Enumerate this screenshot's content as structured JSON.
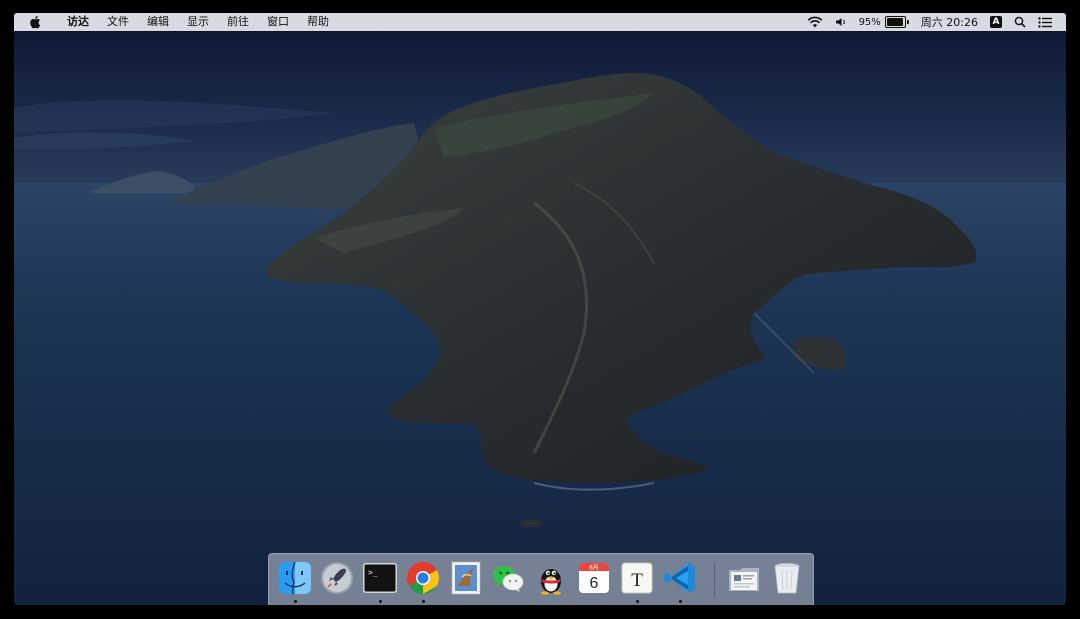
{
  "menubar": {
    "apple_icon": "apple-logo-icon",
    "items": [
      {
        "label": "访达",
        "bold": true
      },
      {
        "label": "文件"
      },
      {
        "label": "编辑"
      },
      {
        "label": "显示"
      },
      {
        "label": "前往"
      },
      {
        "label": "窗口"
      },
      {
        "label": "帮助"
      }
    ],
    "status": {
      "wifi_icon": "wifi-icon",
      "volume_icon": "volume-icon",
      "battery_percent": "95%",
      "battery_level": 0.95,
      "clock": "周六 20:26",
      "input_source": "A",
      "spotlight_icon": "search-icon",
      "notification_icon": "notification-center-icon"
    }
  },
  "dock": {
    "apps": [
      {
        "name": "finder",
        "icon": "finder-icon",
        "running": true
      },
      {
        "name": "launchpad",
        "icon": "launchpad-icon",
        "running": false
      },
      {
        "name": "terminal",
        "icon": "terminal-icon",
        "running": true,
        "prompt": ">_"
      },
      {
        "name": "chrome",
        "icon": "chrome-icon",
        "running": true
      },
      {
        "name": "mail",
        "icon": "mail-stamp-icon",
        "running": false
      },
      {
        "name": "wechat",
        "icon": "wechat-icon",
        "running": false
      },
      {
        "name": "qq",
        "icon": "qq-penguin-icon",
        "running": false
      },
      {
        "name": "calendar",
        "icon": "calendar-icon",
        "running": false,
        "month": "6月",
        "day": "6"
      },
      {
        "name": "typora",
        "icon": "typora-icon",
        "running": true,
        "letter": "T"
      },
      {
        "name": "vscode",
        "icon": "vscode-icon",
        "running": true
      }
    ],
    "stacks": [
      {
        "name": "applications-folder",
        "icon": "applications-folder-icon"
      },
      {
        "name": "trash",
        "icon": "trash-icon"
      }
    ]
  },
  "colors": {
    "menubar_bg": "#e8eaf0",
    "sky": "#101a33",
    "sea": "#1a2e4c",
    "dock_bg": "#c6cdda"
  }
}
